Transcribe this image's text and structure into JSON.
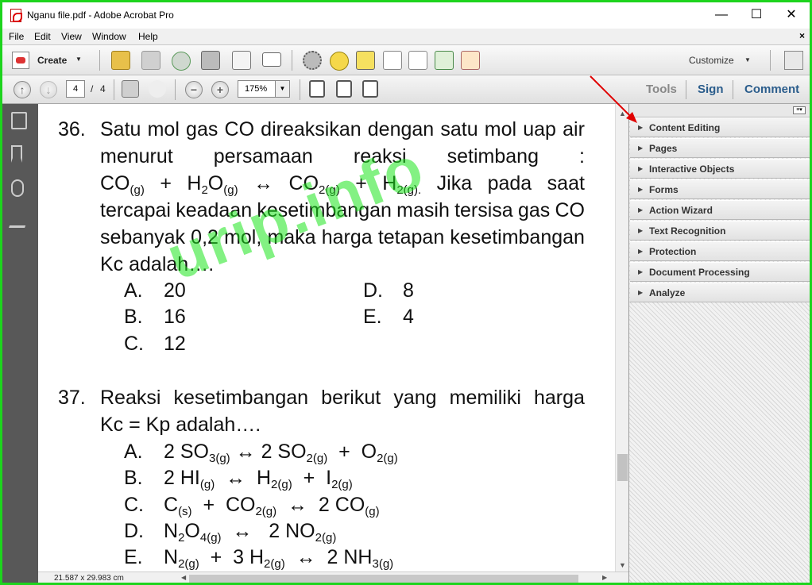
{
  "window": {
    "title": "Nganu file.pdf - Adobe Acrobat Pro",
    "controls": {
      "minimize": "—",
      "maximize": "☐",
      "close": "✕"
    }
  },
  "menu": {
    "items": [
      "File",
      "Edit",
      "View",
      "Window",
      "Help"
    ],
    "close_glyph": "×"
  },
  "toolbar": {
    "create_label": "Create",
    "customize_label": "Customize",
    "icons": [
      "open-icon",
      "save-icon",
      "upload-icon",
      "print-icon",
      "edit-icon",
      "email-icon",
      "gear-icon",
      "comment-icon",
      "highlight-icon",
      "delete-icon",
      "find-icon",
      "export-icon",
      "sign-icon"
    ]
  },
  "navbar": {
    "current_page": "4",
    "page_separator": "/",
    "total_pages": "4",
    "zoom": "175%",
    "tabs": {
      "tools": "Tools",
      "sign": "Sign",
      "comment": "Comment"
    }
  },
  "document": {
    "watermark": "urip.info",
    "q36": {
      "number": "36.",
      "line1": [
        "Satu",
        "mol",
        "gas",
        "CO",
        "direaksikan",
        "dengan",
        "satu",
        "mol",
        "uap",
        "air"
      ],
      "line2": [
        "menurut",
        "persamaan",
        "reaksi",
        "setimbang",
        ":"
      ],
      "line4": [
        "tercapai",
        "keadaan",
        "kesetimbangan",
        "masih",
        "tersisa",
        "gas",
        "CO"
      ],
      "line5": [
        "sebanyak",
        "0,2",
        "mol,",
        "maka",
        "harga",
        "tetapan",
        "kesetimbangan"
      ],
      "line6": "Kc adalah….",
      "options": [
        {
          "letter": "A.",
          "value": "20"
        },
        {
          "letter": "B.",
          "value": "16"
        },
        {
          "letter": "C.",
          "value": "12"
        },
        {
          "letter": "D.",
          "value": "8"
        },
        {
          "letter": "E.",
          "value": "4"
        }
      ]
    },
    "q37": {
      "number": "37.",
      "line1": [
        "Reaksi",
        "kesetimbangan",
        "berikut",
        "yang",
        "memiliki",
        "harga"
      ],
      "line2": "Kc = Kp adalah….",
      "options": [
        "A.",
        "B.",
        "C.",
        "D.",
        "E."
      ]
    }
  },
  "status": {
    "page_size": "21.587 x 29.983 cm"
  },
  "tools_panel": {
    "panels": [
      "Content Editing",
      "Pages",
      "Interactive Objects",
      "Forms",
      "Action Wizard",
      "Text Recognition",
      "Protection",
      "Document Processing",
      "Analyze"
    ]
  },
  "colors": {
    "window_border": "#1dd41d",
    "watermark": "#1ee61e",
    "left_nav": "#585858",
    "sign_tab": "#2b5d8c",
    "comment_tab": "#2b5d8c",
    "annotation_arrow": "#e00000"
  }
}
